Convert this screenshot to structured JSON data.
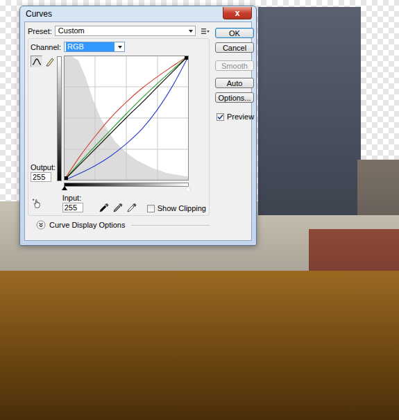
{
  "window": {
    "title": "Curves",
    "close": "x"
  },
  "preset": {
    "label": "Preset:",
    "value": "Custom"
  },
  "channel": {
    "label": "Channel:",
    "value": "RGB",
    "focused": true
  },
  "tools": [
    {
      "kind": "curve",
      "selected": true
    },
    {
      "kind": "pencil",
      "selected": false
    }
  ],
  "output": {
    "label": "Output:",
    "value": "255"
  },
  "input": {
    "label": "Input:",
    "value": "255"
  },
  "eyedroppers": [
    {
      "color": "#111111"
    },
    {
      "color": "#8a8a8a"
    },
    {
      "color": "#ffffff"
    }
  ],
  "show_clipping": {
    "label": "Show Clipping",
    "checked": false
  },
  "display_options": {
    "label": "Curve Display Options",
    "expanded": false
  },
  "buttons": [
    {
      "label": "OK",
      "default": true,
      "disabled": false
    },
    {
      "label": "Cancel",
      "default": false,
      "disabled": false
    },
    {
      "label": "Smooth",
      "default": false,
      "disabled": true
    },
    {
      "label": "Auto",
      "default": false,
      "disabled": false
    },
    {
      "label": "Options...",
      "default": false,
      "disabled": false
    }
  ],
  "preview": {
    "label": "Preview",
    "checked": true
  },
  "graph": {
    "input_range": {
      "black": 0,
      "white": 1
    },
    "histogram": [
      1,
      1,
      0.96,
      0.82,
      0.64,
      0.5,
      0.4,
      0.31,
      0.25,
      0.2,
      0.16,
      0.13,
      0.1,
      0.08,
      0.06,
      0.05,
      0.04,
      0.03
    ],
    "curves": [
      {
        "channel": "red",
        "color": "#d03a2a",
        "values": [
          0,
          48,
          90,
          128,
          160,
          188,
          212,
          234,
          255
        ]
      },
      {
        "channel": "green",
        "color": "#1f9a2a",
        "values": [
          0,
          36,
          70,
          103,
          136,
          168,
          198,
          227,
          255
        ]
      },
      {
        "channel": "blue",
        "color": "#2a3ad0",
        "values": [
          0,
          14,
          30,
          50,
          75,
          105,
          145,
          195,
          255
        ]
      },
      {
        "channel": "rgb",
        "color": "#000000",
        "values": [
          0,
          32,
          64,
          96,
          128,
          159,
          191,
          223,
          255
        ]
      }
    ]
  }
}
